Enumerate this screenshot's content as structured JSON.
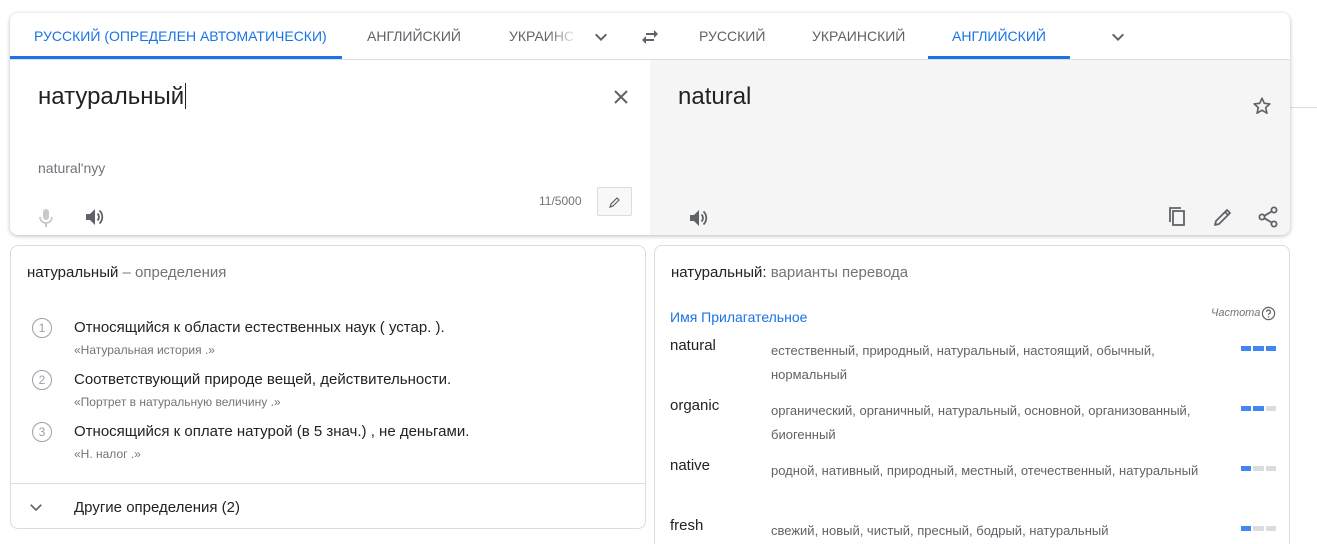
{
  "source_tabs": [
    {
      "label": "Русский (определен автоматически)",
      "active": true
    },
    {
      "label": "Английский",
      "active": false
    },
    {
      "label": "Украинский",
      "active": false
    }
  ],
  "target_tabs": [
    {
      "label": "Русский",
      "active": false
    },
    {
      "label": "Украинский",
      "active": false
    },
    {
      "label": "Английский",
      "active": true
    }
  ],
  "icons": {
    "source_more": "chevron-down-icon",
    "swap": "swap-languages-icon",
    "target_more": "chevron-down-icon",
    "clear": "close-icon",
    "mic": "microphone-icon",
    "speaker": "speaker-icon",
    "edit": "pencil-icon",
    "star": "star-icon",
    "copy": "copy-icon",
    "share": "share-icon",
    "help": "help-circle-icon"
  },
  "source": {
    "text": "натуральный",
    "transliteration": "natural'nyy",
    "counter": "11/5000"
  },
  "target": {
    "text": "natural"
  },
  "definitions": {
    "title_word": "натуральный",
    "title_suffix": "– определения",
    "items": [
      {
        "num": "1",
        "text": "Относящийся к области естественных наук ( устар. ).",
        "example": "«Натуральная история .»"
      },
      {
        "num": "2",
        "text": "Соответствующий природе вещей, действительности.",
        "example": "«Портрет в натуральную величину .»"
      },
      {
        "num": "3",
        "text": "Относящийся к оплате натурой (в 5 знач.) , не деньгами.",
        "example": "«Н. налог .»"
      }
    ],
    "more_label": "Другие определения (2)"
  },
  "translations": {
    "title_word": "натуральный:",
    "title_suffix": "варианты перевода",
    "part_of_speech": "Имя Прилагательное",
    "frequency_label": "Частота",
    "rows": [
      {
        "word": "natural",
        "synonyms": "естественный, природный, натуральный, настоящий, обычный, нормальный",
        "frequency": 3
      },
      {
        "word": "organic",
        "synonyms": "органический, органичный, натуральный, основной, организованный, биогенный",
        "frequency": 2
      },
      {
        "word": "native",
        "synonyms": "родной, нативный, природный, местный, отечественный, натуральный",
        "frequency": 1
      },
      {
        "word": "fresh",
        "synonyms": "свежий, новый, чистый, пресный, бодрый, натуральный",
        "frequency": 1
      }
    ]
  },
  "colors": {
    "accent": "#1a73e8",
    "frequency_on": "#4285f4",
    "frequency_off": "#dadce0",
    "target_background": "#f5f5f5"
  }
}
